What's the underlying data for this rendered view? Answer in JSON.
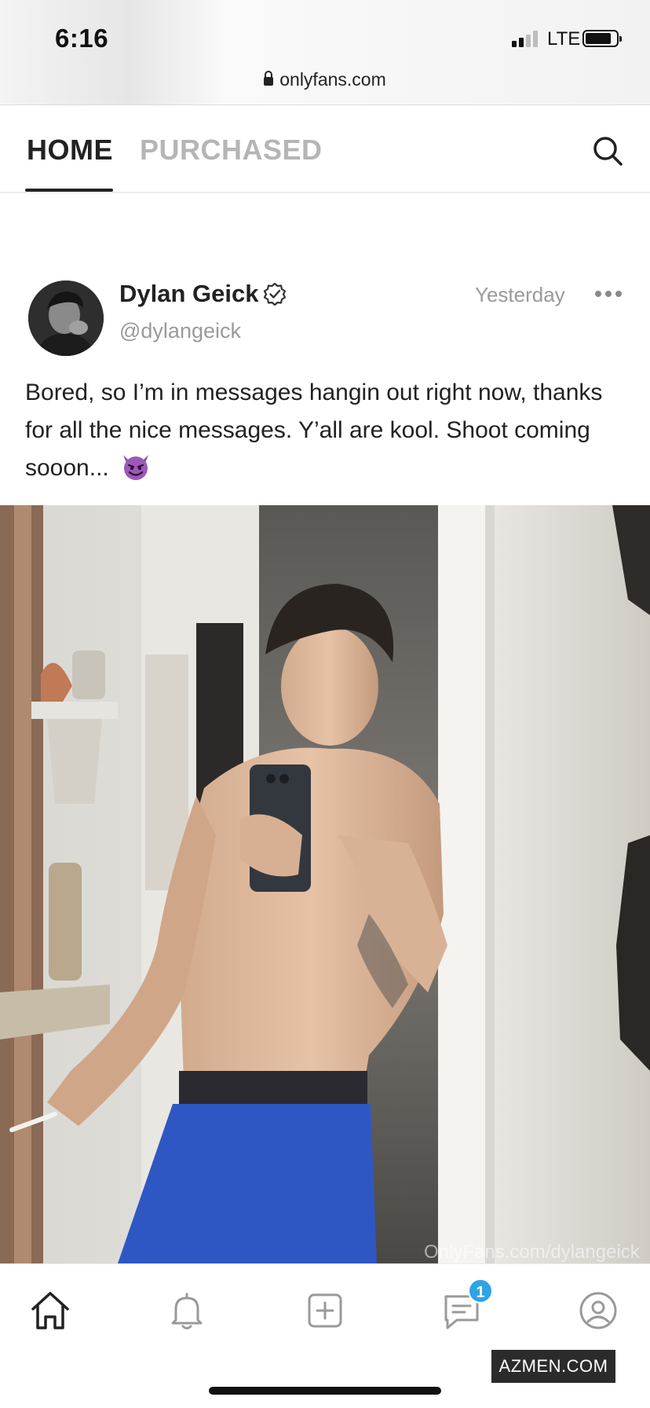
{
  "status_bar": {
    "time": "6:16",
    "network": "LTE",
    "url": "onlyfans.com"
  },
  "top_nav": {
    "tabs": [
      {
        "label": "HOME",
        "active": true
      },
      {
        "label": "PURCHASED",
        "active": false
      }
    ],
    "search_icon": "search-icon"
  },
  "post": {
    "author_name": "Dylan Geick",
    "verified_icon": "verified-badge-icon",
    "handle": "@dylangeick",
    "date": "Yesterday",
    "more_icon": "more-horizontal-icon",
    "text": "Bored, so I’m in messages hangin out right now, thanks for all the nice messages. Y’all are kool. Shoot coming sooon...",
    "emoji": "smiling-imp-emoji",
    "watermark": "OnlyFans.com/dylangeick"
  },
  "bottom_nav": {
    "items": [
      {
        "icon": "home-icon"
      },
      {
        "icon": "bell-icon"
      },
      {
        "icon": "add-post-icon"
      },
      {
        "icon": "messages-icon"
      },
      {
        "icon": "profile-icon"
      }
    ],
    "messages_badge": "1"
  },
  "overlay_watermark": "AZMEN.COM",
  "colors": {
    "accent": "#2ea3e6",
    "text": "#222222",
    "muted": "#9a9a9a"
  }
}
